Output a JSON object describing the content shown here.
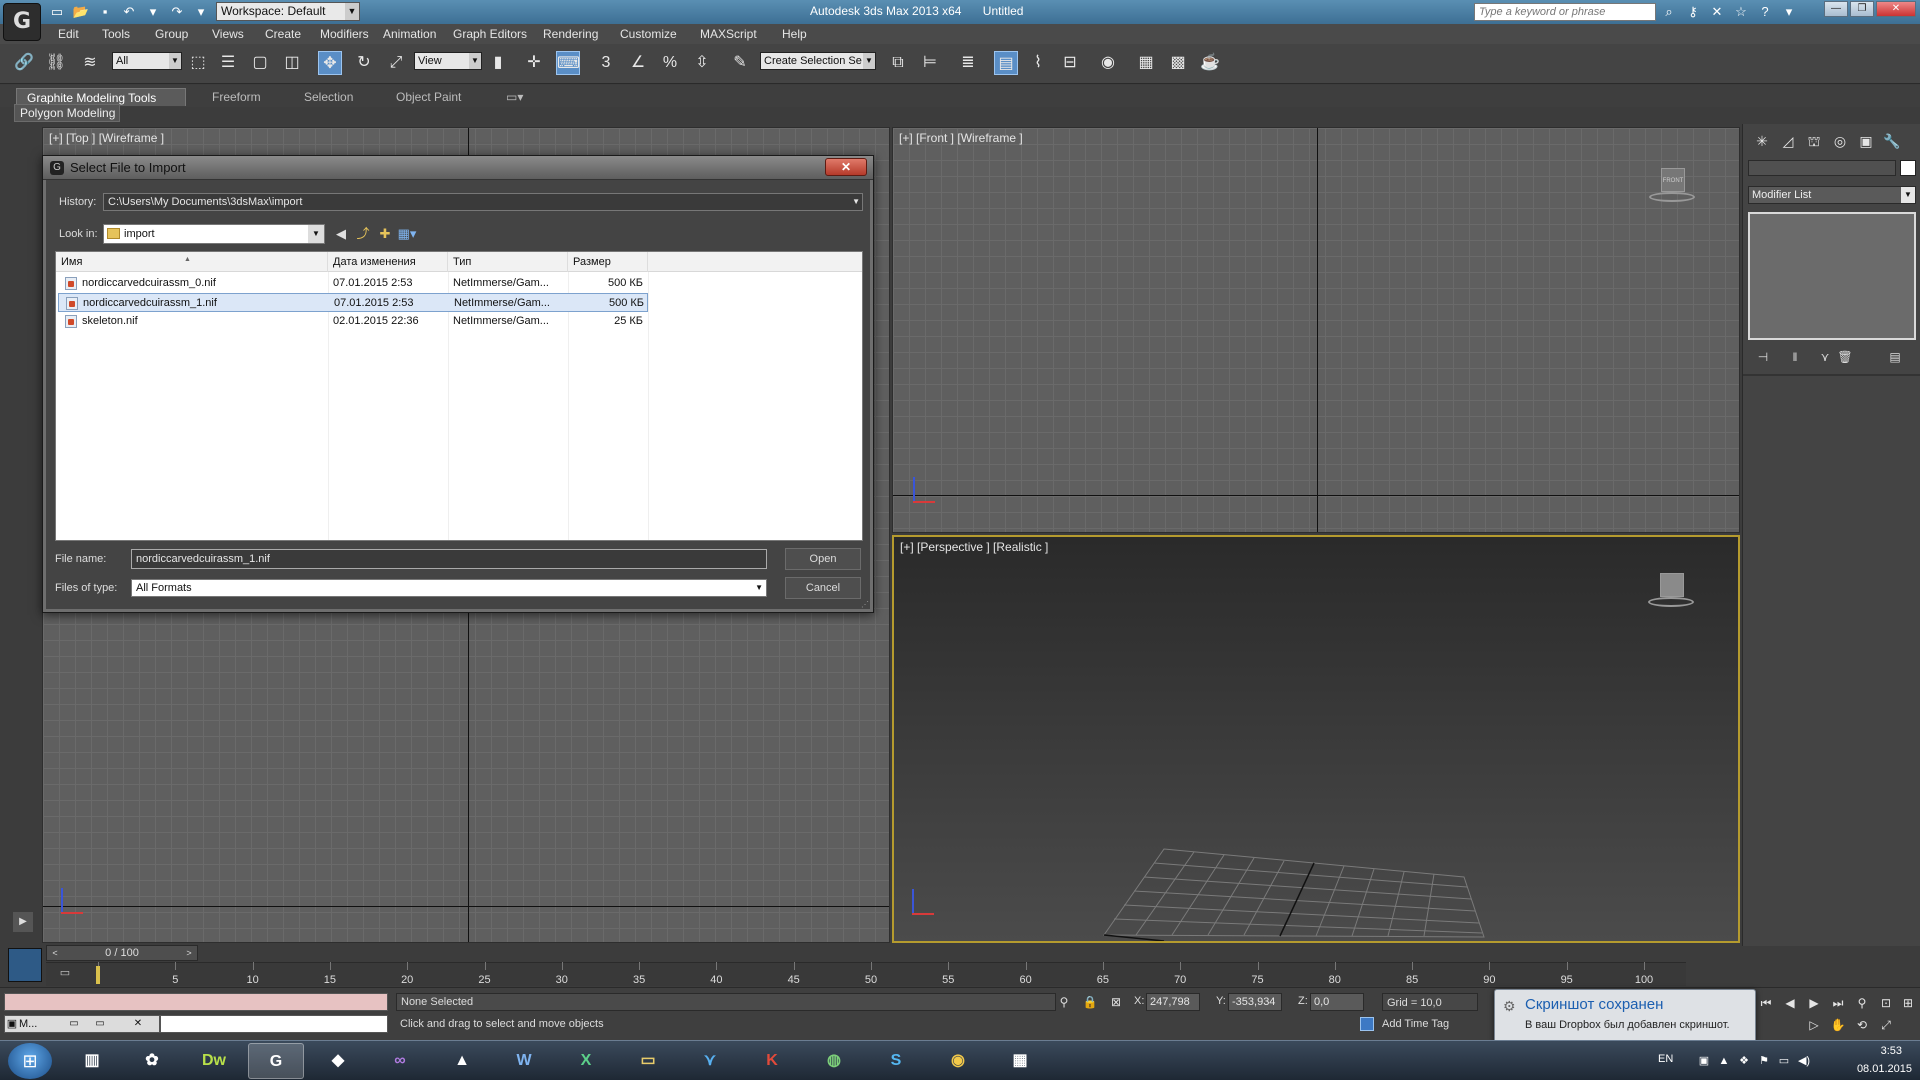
{
  "titlebar": {
    "workspace": "Workspace: Default",
    "app_title": "Autodesk 3ds Max  2013 x64",
    "doc_title": "Untitled",
    "search_placeholder": "Type a keyword or phrase",
    "logo_glyph": "G"
  },
  "menu": [
    "Edit",
    "Tools",
    "Group",
    "Views",
    "Create",
    "Modifiers",
    "Animation",
    "Graph Editors",
    "Rendering",
    "Customize",
    "MAXScript",
    "Help"
  ],
  "toolbar": {
    "filter": "All",
    "ref_coord": "View",
    "selection_set_placeholder": "Create Selection Se",
    "snap_3": "3",
    "percent": "%"
  },
  "ribbon": {
    "tabs": [
      "Graphite Modeling Tools",
      "Freeform",
      "Selection",
      "Object Paint"
    ],
    "panel": "Polygon Modeling"
  },
  "viewports": {
    "top": "[+] [Top ] [Wireframe ]",
    "front": "[+] [Front ] [Wireframe ]",
    "perspective": "[+] [Perspective ] [Realistic ]",
    "front_gizmo": "FRONT"
  },
  "command_panel": {
    "modifier_list": "Modifier List"
  },
  "dialog": {
    "title": "Select File to Import",
    "history_label": "History:",
    "history_path": "C:\\Users\\My Documents\\3dsMax\\import",
    "lookin_label": "Look in:",
    "lookin_value": "import",
    "columns": [
      "Имя",
      "Дата изменения",
      "Тип",
      "Размер"
    ],
    "files": [
      {
        "name": "nordiccarvedcuirassm_0.nif",
        "date": "07.01.2015 2:53",
        "type": "NetImmerse/Gam...",
        "size": "500 КБ"
      },
      {
        "name": "nordiccarvedcuirassm_1.nif",
        "date": "07.01.2015 2:53",
        "type": "NetImmerse/Gam...",
        "size": "500 КБ"
      },
      {
        "name": "skeleton.nif",
        "date": "02.01.2015 22:36",
        "type": "NetImmerse/Gam...",
        "size": "25 КБ"
      }
    ],
    "selected_index": 1,
    "filename_label": "File name:",
    "filename_value": "nordiccarvedcuirassm_1.nif",
    "filetype_label": "Files of type:",
    "filetype_value": "All Formats",
    "open_label": "Open",
    "cancel_label": "Cancel"
  },
  "timeline": {
    "frame_display": "0 / 100",
    "ticks": [
      "5",
      "10",
      "15",
      "20",
      "25",
      "30",
      "35",
      "40",
      "45",
      "50",
      "55",
      "60",
      "65",
      "70",
      "75",
      "80",
      "85",
      "90",
      "95",
      "100"
    ],
    "current_frame": 0,
    "total_frames": 100
  },
  "status": {
    "mini_listener": "M...",
    "selection": "None Selected",
    "prompt": "Click and drag to select and move objects",
    "x_label": "X:",
    "x_value": "247,798",
    "y_label": "Y:",
    "y_value": "-353,934",
    "z_label": "Z:",
    "z_value": "0,0",
    "grid": "Grid = 10,0",
    "add_time_tag": "Add Time Tag"
  },
  "notification": {
    "title": "Скриншот сохранен",
    "body": "В ваш Dropbox был добавлен скриншот."
  },
  "taskbar": {
    "apps": [
      "Explorer",
      "Photos",
      "Dw",
      "3ds Max",
      "App",
      "Visual Studio",
      "Acrobat",
      "W",
      "X",
      "Folder",
      "App2",
      "Kaspersky",
      "App3",
      "Skype",
      "Chrome",
      "Media"
    ],
    "lang": "EN",
    "time": "3:53",
    "date": "08.01.2015"
  },
  "colors": {
    "selection_blue": "#5a8ec6",
    "viewport_active_border": "#b59b2e",
    "notification_title": "#1c5fb0"
  }
}
